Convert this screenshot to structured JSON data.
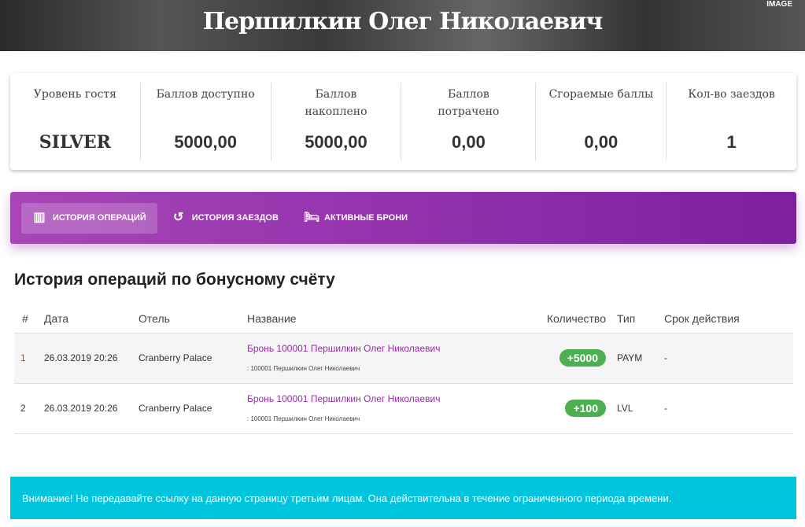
{
  "header": {
    "title": "Першилкин Олег Николаевич",
    "tag": "IMAGE"
  },
  "stats": [
    {
      "label": "Уровень гостя",
      "value": "SILVER"
    },
    {
      "label": "Баллов доступно",
      "value": "5000,00"
    },
    {
      "label": "Баллов накоплено",
      "value": "5000,00"
    },
    {
      "label": "Баллов потрачено",
      "value": "0,00"
    },
    {
      "label": "Сгораемые баллы",
      "value": "0,00"
    },
    {
      "label": "Кол-во заездов",
      "value": "1"
    }
  ],
  "tabs": [
    {
      "label": "ИСТОРИЯ ОПЕРАЦИЙ"
    },
    {
      "label": "ИСТОРИЯ ЗАЕЗДОВ"
    },
    {
      "label": "АКТИВНЫЕ БРОНИ"
    }
  ],
  "section_title": "История операций по бонусному счёту",
  "table": {
    "headers": [
      "#",
      "Дата",
      "Отель",
      "Название",
      "Количество",
      "Тип",
      "Срок действия"
    ],
    "rows": [
      {
        "n": "1",
        "date": "26.03.2019 20:26",
        "hotel": "Cranberry Palace",
        "name": "Бронь 100001 Першилкин Олег Николаевич",
        "sub": ": 100001 Першилкин Олег Николаевич",
        "qty": "+5000",
        "type": "PAYM",
        "exp": "-"
      },
      {
        "n": "2",
        "date": "26.03.2019 20:26",
        "hotel": "Cranberry Palace",
        "name": "Бронь 100001 Першилкин Олег Николаевич",
        "sub": ": 100001 Першилкин Олег Николаевич",
        "qty": "+100",
        "type": "LVL",
        "exp": "-"
      }
    ]
  },
  "notice": "Внимание! Не передавайте ссылку на данную страницу третьим лицам. Она действительна в течение ограниченного периода времени."
}
